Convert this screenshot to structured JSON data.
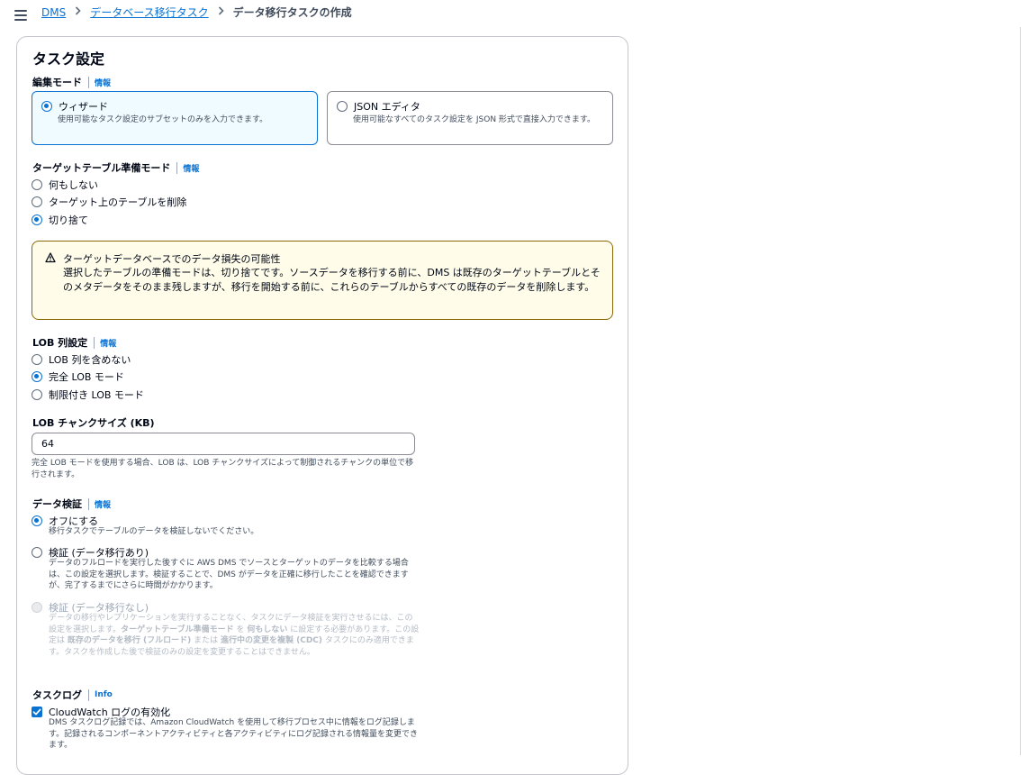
{
  "breadcrumb": {
    "items": [
      "DMS",
      "データベース移行タスク"
    ],
    "current": "データ移行タスクの作成"
  },
  "section": {
    "title": "タスク設定"
  },
  "edit_mode": {
    "label": "編集モード",
    "info": "情報",
    "wizard": {
      "title": "ウィザード",
      "desc": "使用可能なタスク設定のサブセットのみを入力できます。",
      "selected": true
    },
    "json": {
      "title": "JSON エディタ",
      "desc": "使用可能なすべてのタスク設定を JSON 形式で直接入力できます。",
      "selected": false
    }
  },
  "target_prep": {
    "label": "ターゲットテーブル準備モード",
    "info": "情報",
    "options": [
      "何もしない",
      "ターゲット上のテーブルを削除",
      "切り捨て"
    ],
    "selected": "切り捨て"
  },
  "alert": {
    "title": "ターゲットデータベースでのデータ損失の可能性",
    "body": "選択したテーブルの準備モードは、切り捨てです。ソースデータを移行する前に、DMS は既存のターゲットテーブルとそのメタデータをそのまま残しますが、移行を開始する前に、これらのテーブルからすべての既存のデータを削除します。"
  },
  "lob": {
    "label": "LOB 列設定",
    "info": "情報",
    "options": [
      "LOB 列を含めない",
      "完全 LOB モード",
      "制限付き LOB モード"
    ],
    "selected": "完全 LOB モード"
  },
  "lob_chunk": {
    "label": "LOB チャンクサイズ (KB)",
    "value": "64",
    "hint": "完全 LOB モードを使用する場合、LOB は、LOB チャンクサイズによって制御されるチャンクの単位で移行されます。"
  },
  "validation": {
    "label": "データ検証",
    "info": "情報",
    "off": {
      "title": "オフにする",
      "desc": "移行タスクでテーブルのデータを検証しないでください。"
    },
    "with_migration": {
      "title": "検証 (データ移行あり)",
      "desc": "データのフルロードを実行した後すぐに AWS DMS でソースとターゲットのデータを比較する場合は、この設定を選択します。検証することで、DMS がデータを正確に移行したことを確認できますが、完了するまでにさらに時間がかかります。"
    },
    "without_migration": {
      "title": "検証 (データ移行なし)",
      "desc_1": "データの移行やレプリケーションを実行することなく、タスクにデータ検証を実行させるには、この設定を選択します。",
      "desc_b1": "ターゲットテーブル準備モード",
      "desc_2": " を ",
      "desc_b2": "何もしない",
      "desc_3": " に設定する必要があります。この設定は ",
      "desc_b3": "既存のデータを移行 (フルロード)",
      "desc_4": " または ",
      "desc_b4": "進行中の変更を複製 (CDC)",
      "desc_5": " タスクにのみ適用できます。タスクを作成した後で検証のみの設定を変更することはできません。"
    },
    "selected": "off"
  },
  "task_log": {
    "label": "タスクログ",
    "info": "Info",
    "checkbox_label": "CloudWatch ログの有効化",
    "checked": true,
    "desc": "DMS タスクログ記録では、Amazon CloudWatch を使用して移行プロセス中に情報をログ記録します。記録されるコンポーネントアクティビティと各アクティビティにログ記録される情報量を変更できます。"
  }
}
